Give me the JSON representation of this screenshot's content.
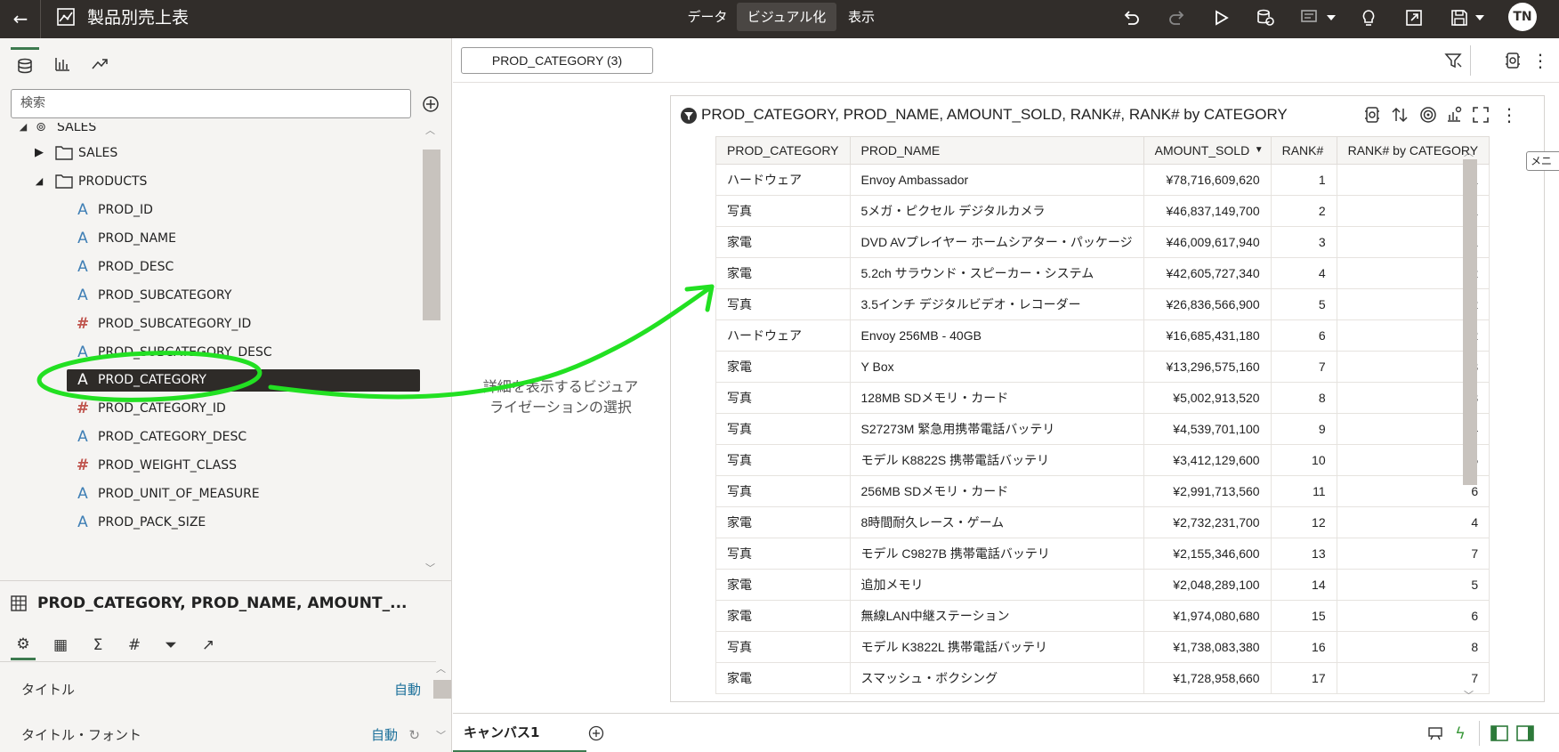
{
  "header": {
    "title": "製品別売上表",
    "tabs": [
      {
        "label": "データ",
        "active": false
      },
      {
        "label": "ビジュアル化",
        "active": true
      },
      {
        "label": "表示",
        "active": false
      }
    ],
    "avatar": "TN"
  },
  "left_panel": {
    "search_placeholder": "検索",
    "tree": [
      {
        "label": "SALES",
        "type": "schema",
        "depth": 0
      },
      {
        "label": "SALES",
        "type": "folder",
        "depth": 1,
        "expanded": false
      },
      {
        "label": "PRODUCTS",
        "type": "folder",
        "depth": 1,
        "expanded": true
      },
      {
        "label": "PROD_ID",
        "type": "attribute",
        "depth": 2
      },
      {
        "label": "PROD_NAME",
        "type": "attribute",
        "depth": 2
      },
      {
        "label": "PROD_DESC",
        "type": "attribute",
        "depth": 2
      },
      {
        "label": "PROD_SUBCATEGORY",
        "type": "attribute",
        "depth": 2
      },
      {
        "label": "PROD_SUBCATEGORY_ID",
        "type": "measure",
        "depth": 2
      },
      {
        "label": "PROD_SUBCATEGORY_DESC",
        "type": "attribute",
        "depth": 2
      },
      {
        "label": "PROD_CATEGORY",
        "type": "attribute",
        "depth": 2,
        "selected": true
      },
      {
        "label": "PROD_CATEGORY_ID",
        "type": "measure",
        "depth": 2
      },
      {
        "label": "PROD_CATEGORY_DESC",
        "type": "attribute",
        "depth": 2
      },
      {
        "label": "PROD_WEIGHT_CLASS",
        "type": "measure",
        "depth": 2
      },
      {
        "label": "PROD_UNIT_OF_MEASURE",
        "type": "attribute",
        "depth": 2
      },
      {
        "label": "PROD_PACK_SIZE",
        "type": "attribute",
        "depth": 2
      }
    ],
    "properties": {
      "title": "PROD_CATEGORY, PROD_NAME, AMOUNT_...",
      "rows": [
        {
          "label": "タイトル",
          "value": "自動"
        },
        {
          "label": "タイトル・フォント",
          "value": "自動"
        }
      ]
    }
  },
  "canvas": {
    "filter_pill": "PROD_CATEGORY (3)",
    "viz_title": "PROD_CATEGORY, PROD_NAME, AMOUNT_SOLD, RANK#, RANK# by CATEGORY",
    "columns": [
      "PROD_CATEGORY",
      "PROD_NAME",
      "AMOUNT_SOLD",
      "RANK#",
      "RANK# by CATEGORY"
    ],
    "rows": [
      [
        "ハードウェア",
        "Envoy Ambassador",
        "¥78,716,609,620",
        "1",
        "1"
      ],
      [
        "写真",
        "5メガ・ピクセル デジタルカメラ",
        "¥46,837,149,700",
        "2",
        "1"
      ],
      [
        "家電",
        "DVD AVプレイヤー ホームシアター・パッケージ",
        "¥46,009,617,940",
        "3",
        "1"
      ],
      [
        "家電",
        "5.2ch サラウンド・スピーカー・システム",
        "¥42,605,727,340",
        "4",
        "2"
      ],
      [
        "写真",
        "3.5インチ デジタルビデオ・レコーダー",
        "¥26,836,566,900",
        "5",
        "2"
      ],
      [
        "ハードウェア",
        "Envoy 256MB - 40GB",
        "¥16,685,431,180",
        "6",
        "2"
      ],
      [
        "家電",
        "Y Box",
        "¥13,296,575,160",
        "7",
        "3"
      ],
      [
        "写真",
        "128MB SDメモリ・カード",
        "¥5,002,913,520",
        "8",
        "3"
      ],
      [
        "写真",
        "S27273M 緊急用携帯電話バッテリ",
        "¥4,539,701,100",
        "9",
        "4"
      ],
      [
        "写真",
        "モデル K8822S 携帯電話バッテリ",
        "¥3,412,129,600",
        "10",
        "5"
      ],
      [
        "写真",
        "256MB SDメモリ・カード",
        "¥2,991,713,560",
        "11",
        "6"
      ],
      [
        "家電",
        "8時間耐久レース・ゲーム",
        "¥2,732,231,700",
        "12",
        "4"
      ],
      [
        "写真",
        "モデル C9827B 携帯電話バッテリ",
        "¥2,155,346,600",
        "13",
        "7"
      ],
      [
        "家電",
        "追加メモリ",
        "¥2,048,289,100",
        "14",
        "5"
      ],
      [
        "家電",
        "無線LAN中継ステーション",
        "¥1,974,080,680",
        "15",
        "6"
      ],
      [
        "写真",
        "モデル K3822L 携帯電話バッテリ",
        "¥1,738,083,380",
        "16",
        "8"
      ],
      [
        "家電",
        "スマッシュ・ボクシング",
        "¥1,728,958,660",
        "17",
        "7"
      ]
    ],
    "menu_tooltip": "メニュー"
  },
  "bottom": {
    "canvas_tab": "キャンバス1"
  },
  "annotation": {
    "text": "詳細を表示するビジュアライゼーションの選択",
    "color": "#22e022"
  }
}
